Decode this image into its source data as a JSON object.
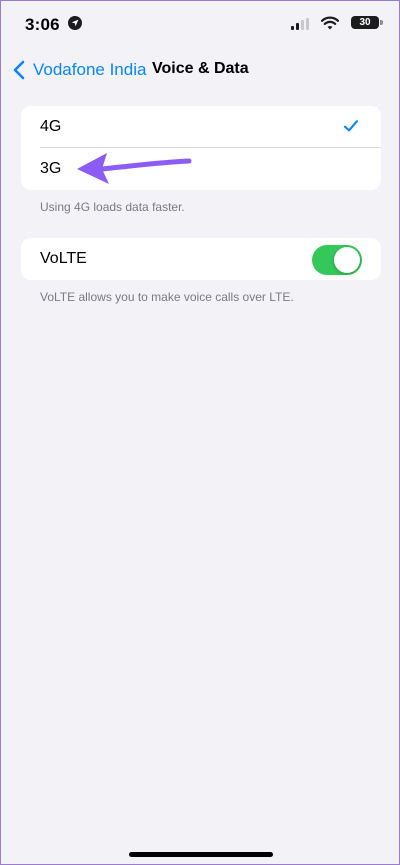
{
  "status_bar": {
    "time": "3:06",
    "battery": "30",
    "location_icon": "location-arrow-icon",
    "signal_icon": "cellular-signal-icon",
    "wifi_icon": "wifi-icon"
  },
  "nav": {
    "back_label": "Vodafone India",
    "title": "Voice & Data",
    "back_icon": "chevron-left-icon"
  },
  "voice_data": {
    "options": [
      {
        "label": "4G",
        "selected": true
      },
      {
        "label": "3G",
        "selected": false
      }
    ],
    "footer": "Using 4G loads data faster."
  },
  "volte": {
    "label": "VoLTE",
    "enabled": true,
    "footer": "VoLTE allows you to make voice calls over LTE."
  },
  "colors": {
    "background": "#F2F2F7",
    "accent": "#0A84FF",
    "toggle_on": "#34C759",
    "annotation_arrow": "#8B5CF6",
    "footer_text": "#7A7A80"
  }
}
